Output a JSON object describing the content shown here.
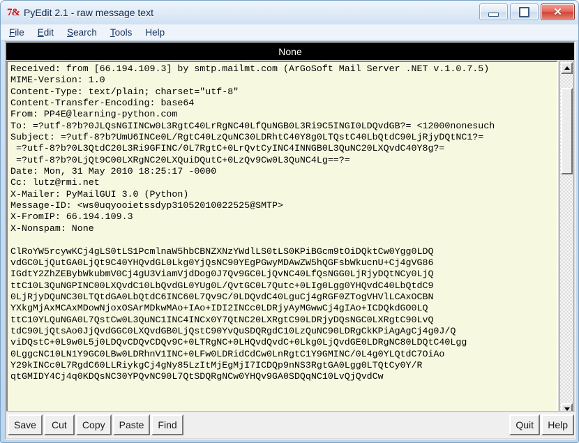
{
  "window": {
    "title": "PyEdit 2.1 - raw message text",
    "icon": "python-logo-icon",
    "controls": {
      "minimize": "minimize-button",
      "maximize": "maximize-button",
      "close": "close-button",
      "close_glyph": "✕"
    }
  },
  "menubar": {
    "items": [
      {
        "label": "File",
        "mnemonic": "F"
      },
      {
        "label": "Edit",
        "mnemonic": "E"
      },
      {
        "label": "Search",
        "mnemonic": "S"
      },
      {
        "label": "Tools",
        "mnemonic": "T"
      },
      {
        "label": "Help",
        "mnemonic": ""
      }
    ]
  },
  "message_bar": {
    "text": "None"
  },
  "editor": {
    "background_color": "#f7f8e0",
    "content": "Received: from [66.194.109.3] by smtp.mailmt.com (ArGoSoft Mail Server .NET v.1.0.7.5)\nMIME-Version: 1.0\nContent-Type: text/plain; charset=\"utf-8\"\nContent-Transfer-Encoding: base64\nFrom: PP4E@learning-python.com\nTo: =?utf-8?b?0JLQsNGIINCw0L3RgtC40LrRgNC40LfQuNGB0L3Ri9C5INGI0LDQvdGB?= <12000nonesuch\nSubject: =?utf-8?b?UmU6INCe0L/RgtC40LzQuNC30LDRhtC40Y8g0LTQstC40LbQtdC90LjRjyDQtNC1?=\n =?utf-8?b?0L3QtdC20L3Ri9GFINC/0L7RgtC+0LrQvtCyINC4INNGB0L3QuNC20LXQvdC40Y8g?=\n =?utf-8?b?0LjQt9C00LXRgNC20LXQuiDQutC+0LzQv9Cw0L3QuNC4Lg==?=\nDate: Mon, 31 May 2010 18:25:17 -0000\nCc: lutz@rmi.net\nX-Mailer: PyMailGUI 3.0 (Python)\nMessage-ID: <ws0uqyooietssdyp31052010022525@SMTP>\nX-FromIP: 66.194.109.3\nX-Nonspam: None\n\nClRoYW5rcywKCj4gLS0tLS1PcmlnaW5hbCBNZXNzYWdlLS0tLS0KPiBGcm9tOiDQktCw0Ygg0LDQ\nvdGC0LjQutGA0LjQt9C40YHQvdGL0Lkg0YjQsNC90YEgPGwyMDAwZW5hQGFsbWkucnU+Cj4gVG86\nIGdtY2ZhZEBybWkubmV0Cj4gU3ViamVjdDog0J7Qv9GC0LjQvNC40LfQsNGG0LjRjyDQtNCy0LjQ\nttC10L3QuNGPINC00LXQvdC10LbQvdGL0YUg0L/QvtGC0L7Qutc+0LIg0Lgg0YHQvdC40LbQtdC9\n0LjRjyDQuNC30LTQtdGA0LbQtdC6INC60L7Qv9C/0LDQvdC40LguCj4gRGF0ZTogVHVlLCAxOCBN\nYXkgMjAxMCAxMDowNjoxOSArMDkwMAo+IAo+IDI2INCc0LDRjyAyMGwwCj4gIAo+ICDQkdGO0LQ\nttC10YLQuNGA0L7QstCw0L3QuNC1INC4INCx0Y7QtNC20LXRgtC90LDRjyDQsNGC0LXRgtC90LvQ\ntdC90LjQtsAo0JjQvdGGC0LXQvdGB0LjQstC90YvQuSDQRgdC10LzQuNC90LDRgCkKPiAgAgCj4g0J/Q\nviDQstC+0L9w0L5j0LDQvCDQvCDQv9C+0LTRgNC+0LHQvdQvdC+0Lkg0LjQvdGE0LDRgNC80LDQtC40Lgg\n0LggcNC10LN1Y9GC0LBw0LDRhnV1INC+0LFw0LDRidCdCw0LnRgtC1Y9GMINC/0L4g0YLQtdC7OiAo\nY29kINCc0L7RgdC60LLRiykgCj4gNy85LzItMjEgMjI7ICDQp9nNS3RgtGA0Lgg0LTQtCy0Y/R\nqtGMIDY4Cj4q0KDQsNC30YPQvNC90L7QtSDQRgNCw0YHQv9GA0SDQqNC10LvQjQvdCw\n"
  },
  "scrollbars": {
    "vertical": {
      "up": "scroll-up-arrow",
      "down": "scroll-down-arrow"
    },
    "horizontal": {
      "left": "scroll-left-arrow",
      "right": "scroll-right-arrow"
    }
  },
  "toolbar": {
    "buttons_left": [
      "Save",
      "Cut",
      "Copy",
      "Paste",
      "Find"
    ],
    "buttons_right": [
      "Quit",
      "Help"
    ]
  }
}
